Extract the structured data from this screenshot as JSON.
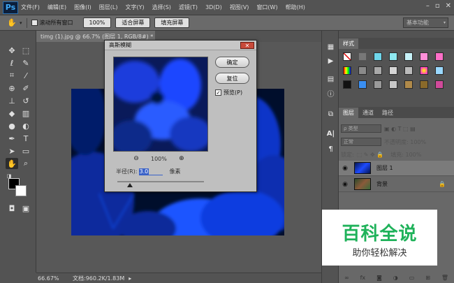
{
  "app": {
    "logo": "Ps",
    "menus": [
      "文件(F)",
      "编辑(E)",
      "图像(I)",
      "图层(L)",
      "文字(Y)",
      "选择(S)",
      "滤镜(T)",
      "3D(D)",
      "视图(V)",
      "窗口(W)",
      "帮助(H)"
    ]
  },
  "options": {
    "scroll_all": "滚动所有窗口",
    "zoom_btn": "100%",
    "fit_btn": "适合屏幕",
    "fill_btn": "填充屏幕",
    "workspace": "基本功能"
  },
  "document": {
    "tab": "timg (1).jpg @ 66.7% (图层 1, RGB/8#) *  ×",
    "status_zoom": "66.67%",
    "status_doc": "文档:960.2K/1.83M"
  },
  "dialog": {
    "title": "高斯模糊",
    "ok": "确定",
    "reset": "复位",
    "preview_label": "预览(P)",
    "zoom_value": "100%",
    "radius_label": "半径(R):",
    "radius_value": "3.0",
    "radius_unit": "像素"
  },
  "styles_panel": {
    "tab": "样式"
  },
  "layers_panel": {
    "tabs": [
      "图层",
      "通道",
      "路径"
    ],
    "kind_filter": "ρ 类型",
    "blend_mode": "正常",
    "opacity": "不透明度: 100%",
    "lock_label": "锁定:",
    "fill": "填充: 100%",
    "layers": [
      {
        "name": "图层 1",
        "selected": true
      },
      {
        "name": "背景",
        "selected": false
      }
    ]
  },
  "watermark": {
    "title": "百科全说",
    "subtitle": "助你轻松解决"
  },
  "colors": {
    "accent_blue": "#1f3cff",
    "watermark_green": "#1fb25a"
  }
}
